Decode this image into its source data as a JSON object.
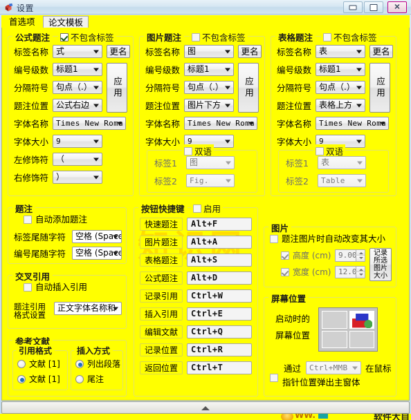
{
  "window": {
    "title": "设置",
    "minimize_label": "最小化",
    "maximize_label": "最大化",
    "close_label": "关闭"
  },
  "tabs": [
    {
      "label": "首选项",
      "selected": true
    },
    {
      "label": "论文模板",
      "selected": false
    }
  ],
  "watermark": "知识网",
  "formula_caption": {
    "title": "公式题注",
    "exclude_label": "不包含标签",
    "exclude_checked": true,
    "rows": [
      {
        "label": "标签名称",
        "value": "式"
      },
      {
        "label": "编号级数",
        "value": "标题1"
      },
      {
        "label": "分隔符号",
        "value": "句点（.）"
      },
      {
        "label": "题注位置",
        "value": "公式右边"
      },
      {
        "label": "字体名称",
        "value": "Times New Roma"
      },
      {
        "label": "字体大小",
        "value": "9"
      },
      {
        "label": "左修饰符",
        "value": "（"
      },
      {
        "label": "右修饰符",
        "value": "）"
      }
    ],
    "rename_button": "更名",
    "apply_button": "应用"
  },
  "picture_caption": {
    "title": "图片题注",
    "exclude_label": "不包含标签",
    "exclude_checked": false,
    "rows": [
      {
        "label": "标签名称",
        "value": "图"
      },
      {
        "label": "编号级数",
        "value": "标题1"
      },
      {
        "label": "分隔符号",
        "value": "句点（.）"
      },
      {
        "label": "题注位置",
        "value": "图片下方"
      },
      {
        "label": "字体名称",
        "value": "Times New Roma"
      },
      {
        "label": "字体大小",
        "value": "9"
      }
    ],
    "rename_button": "更名",
    "apply_button": "应用",
    "bilingual": {
      "title": "双语",
      "checked": false,
      "rows": [
        {
          "label": "标签1",
          "value": "图"
        },
        {
          "label": "标签2",
          "value": "Fig."
        }
      ]
    }
  },
  "table_caption": {
    "title": "表格题注",
    "exclude_label": "不包含标签",
    "exclude_checked": false,
    "rows": [
      {
        "label": "标签名称",
        "value": "表"
      },
      {
        "label": "编号级数",
        "value": "标题1"
      },
      {
        "label": "分隔符号",
        "value": "句点（.）"
      },
      {
        "label": "题注位置",
        "value": "表格上方"
      },
      {
        "label": "字体名称",
        "value": "Times New Roma"
      },
      {
        "label": "字体大小",
        "value": "9"
      }
    ],
    "rename_button": "更名",
    "apply_button": "应用",
    "bilingual": {
      "title": "双语",
      "checked": false,
      "rows": [
        {
          "label": "标签1",
          "value": "表"
        },
        {
          "label": "标签2",
          "value": "Table"
        }
      ]
    }
  },
  "caption": {
    "title": "题注",
    "auto_add_label": "自动添加题注",
    "auto_add_checked": false,
    "rows": [
      {
        "label": "标签尾随字符",
        "value": "空格 (Space)"
      },
      {
        "label": "编号尾随字符",
        "value": "空格 (Space)"
      }
    ]
  },
  "cross_reference": {
    "title": "交叉引用",
    "auto_insert_label": "自动插入引用",
    "auto_insert_checked": false,
    "format_label_line1": "题注引用",
    "format_label_line2": "格式设置",
    "format_value": "正文字体名称和"
  },
  "references": {
    "title": "参考文献",
    "cite_format": {
      "title": "引用格式",
      "options": [
        {
          "label": "文献 [1]",
          "selected": false
        },
        {
          "label": "文献 [1]",
          "selected": true,
          "superscript": true
        }
      ]
    },
    "insert_mode": {
      "title": "插入方式",
      "options": [
        {
          "label": "列出段落",
          "selected": true
        },
        {
          "label": "尾注",
          "selected": false
        }
      ]
    }
  },
  "shortcuts": {
    "title": "按钮快捷键",
    "enable_label": "启用",
    "enable_checked": false,
    "items": [
      {
        "label": "快速题注",
        "key": "Alt+F"
      },
      {
        "label": "图片题注",
        "key": "Alt+A"
      },
      {
        "label": "表格题注",
        "key": "Alt+S"
      },
      {
        "label": "公式题注",
        "key": "Alt+D"
      },
      {
        "label": "记录引用",
        "key": "Ctrl+W"
      },
      {
        "label": "插入引用",
        "key": "Ctrl+E"
      },
      {
        "label": "编辑文献",
        "key": "Ctrl+Q"
      },
      {
        "label": "记录位置",
        "key": "Ctrl+R"
      },
      {
        "label": "返回位置",
        "key": "Ctrl+T"
      }
    ]
  },
  "picture": {
    "title": "图片",
    "auto_resize_label": "题注图片时自动改变其大小",
    "auto_resize_checked": false,
    "height": {
      "label": "高度 (cm)",
      "value": "9.00",
      "checked": true
    },
    "width": {
      "label": "宽度 (cm)",
      "value": "12.00",
      "checked": true
    },
    "record_button_lines": [
      "记录",
      "所选",
      "图片",
      "大小"
    ]
  },
  "screen_position": {
    "title": "屏幕位置",
    "label_line1": "启动时的",
    "label_line2": "屏幕位置",
    "active_quadrant": "top-right",
    "popup_prefix": "通过",
    "popup_hotkey": "Ctrl+MMB",
    "popup_suffix": "在鼠标",
    "popup_line2": "指针位置弹出主窗体",
    "popup_checked": false
  },
  "bottom_bar": {
    "collapse_label": "折叠"
  },
  "footer": {
    "www": "WW.",
    "logo": "软件大自"
  }
}
